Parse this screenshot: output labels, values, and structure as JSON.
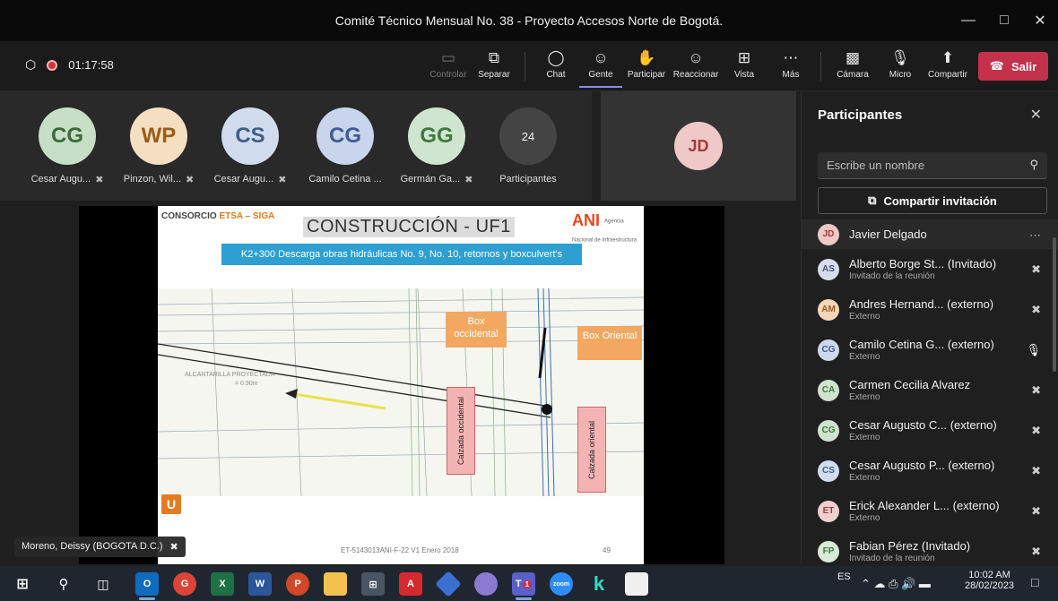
{
  "window": {
    "title": "Comité Técnico Mensual No. 38 - Proyecto Accesos Norte de Bogotá."
  },
  "toolbar": {
    "timer": "01:17:58",
    "buttons": [
      {
        "label": "Controlar",
        "icon": "control-icon"
      },
      {
        "label": "Separar",
        "icon": "popout-icon"
      },
      {
        "label": "Chat",
        "icon": "chat-icon"
      },
      {
        "label": "Gente",
        "icon": "people-icon"
      },
      {
        "label": "Participar",
        "icon": "raise-hand-icon"
      },
      {
        "label": "Reaccionar",
        "icon": "smiley-icon"
      },
      {
        "label": "Vista",
        "icon": "grid-view-icon"
      },
      {
        "label": "Más",
        "icon": "more-icon"
      },
      {
        "label": "Cámara",
        "icon": "camera-off-icon"
      },
      {
        "label": "Micro",
        "icon": "mic-off-icon"
      },
      {
        "label": "Compartir",
        "icon": "share-icon"
      }
    ],
    "leave_label": "Salir"
  },
  "gallery": {
    "tiles": [
      {
        "initials": "CG",
        "name": "Cesar Augu...",
        "color": "#c7dfc7",
        "text": "#3a6a3a"
      },
      {
        "initials": "WP",
        "name": "Pinzon, Wil...",
        "color": "#f4dfc2",
        "text": "#9b5c17"
      },
      {
        "initials": "CS",
        "name": "Cesar Augu...",
        "color": "#d1dcef",
        "text": "#3f5e8c"
      },
      {
        "initials": "CG",
        "name": "Camilo Cetina ...",
        "color": "#c9d5ec",
        "text": "#3f5a94"
      },
      {
        "initials": "GG",
        "name": "Germán Ga...",
        "color": "#cfe5cf",
        "text": "#3f7a3f"
      }
    ],
    "more_count": "24",
    "more_label": "Participantes",
    "pinned_initials": "JD"
  },
  "slide": {
    "logo_left_a": "CONSORCIO ",
    "logo_left_b": "ETSA – SIGA",
    "title": "CONSTRUCCIÓN - UF1",
    "ani_logo": "ANI",
    "ani_sub": "Agencia Nacional de Infraestructura",
    "banner": "K2+300 Descarga obras hidráulicas No. 9, No. 10, retornos y boxculvert's",
    "labels": {
      "box_occ": "Box occidental",
      "box_ori": "Box Oriental",
      "calz_occ": "Calzada occidental",
      "calz_ori": "Calzada oriental",
      "alcantarilla": "ALCANTARILLA PROYECTADA",
      "alcantarilla_dim": "= 0.90m"
    },
    "footer_code": "ET-5143013ANI-F-22 V1 Enero 2018",
    "page_number": "49",
    "u_logo": "U"
  },
  "presenter": {
    "name": "Moreno, Deissy (BOGOTA D.C.)"
  },
  "panel": {
    "title": "Participantes",
    "search_placeholder": "Escribe un nombre",
    "share_label": "Compartir invitación",
    "people": [
      {
        "initials": "JD",
        "name": "Javier Delgado",
        "sub": "",
        "status": "···",
        "bg": "#f0c8c8",
        "fg": "#a33a3a"
      },
      {
        "initials": "AS",
        "name": "Alberto Borge St... (Invitado)",
        "sub": "Invitado de la reunión",
        "status": "mic-off",
        "bg": "#d6dcea",
        "fg": "#44557a"
      },
      {
        "initials": "AM",
        "name": "Andres Hernand... (externo)",
        "sub": "Externo",
        "status": "mic-off",
        "bg": "#f4d6b8",
        "fg": "#a65a17"
      },
      {
        "initials": "CG",
        "name": "Camilo Cetina G... (externo)",
        "sub": "Externo",
        "status": "mic-on",
        "bg": "#cdd8ee",
        "fg": "#3f5a94"
      },
      {
        "initials": "CA",
        "name": "Carmen Cecilia Alvarez",
        "sub": "Externo",
        "status": "mic-off",
        "bg": "#cfe3cf",
        "fg": "#3f7a3f"
      },
      {
        "initials": "CG",
        "name": "Cesar Augusto C... (externo)",
        "sub": "Externo",
        "status": "mic-off",
        "bg": "#cfe3cf",
        "fg": "#3f7a3f"
      },
      {
        "initials": "CS",
        "name": "Cesar Augusto P... (externo)",
        "sub": "Externo",
        "status": "mic-off",
        "bg": "#d1dcef",
        "fg": "#3f5e8c"
      },
      {
        "initials": "ET",
        "name": "Erick Alexander L... (externo)",
        "sub": "Externo",
        "status": "mic-off",
        "bg": "#f0cfcf",
        "fg": "#9a3f3f"
      },
      {
        "initials": "FP",
        "name": "Fabian Pérez (Invitado)",
        "sub": "Invitado de la reunión",
        "status": "mic-off",
        "bg": "#d8ead8",
        "fg": "#3f7a3f"
      }
    ]
  },
  "taskbar": {
    "lang": "ES",
    "time": "10:02 AM",
    "date": "28/02/2023",
    "apps": [
      "windows-start-icon",
      "search-icon",
      "task-view-icon",
      "outlook-icon",
      "chrome-icon",
      "excel-icon",
      "word-icon",
      "powerpoint-icon",
      "file-explorer-icon",
      "calculator-icon",
      "acrobat-icon",
      "azure-icon",
      "paint-icon",
      "teams-icon",
      "zoom-icon",
      "k-app-icon",
      "notepad-icon"
    ],
    "zoom_label": "zoom",
    "teams_badge": "1"
  }
}
